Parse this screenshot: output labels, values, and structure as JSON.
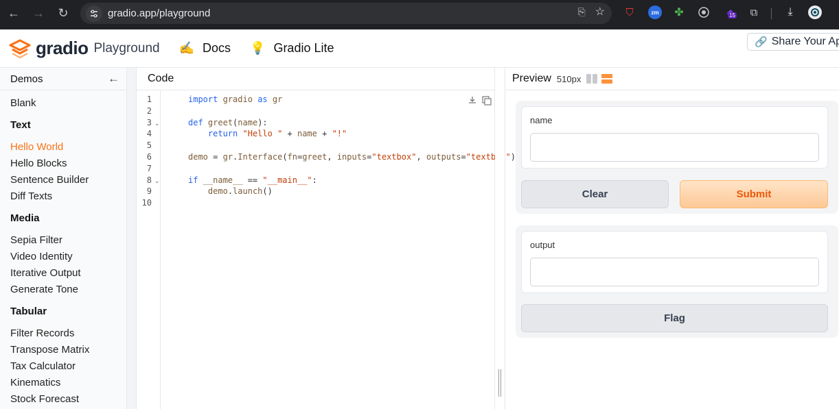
{
  "browser": {
    "url": "gradio.app/playground",
    "extension_badge": "15",
    "zm": "zm"
  },
  "header": {
    "brand": "gradio",
    "brand_sub": "Playground",
    "nav": [
      {
        "emoji": "✍️",
        "label": "Docs"
      },
      {
        "emoji": "💡",
        "label": "Gradio Lite"
      }
    ],
    "share_label": "Share Your App"
  },
  "sidebar": {
    "title": "Demos",
    "items": [
      {
        "label": "Blank",
        "type": "item"
      },
      {
        "label": "Text",
        "type": "category"
      },
      {
        "label": "Hello World",
        "type": "item",
        "active": true
      },
      {
        "label": "Hello Blocks",
        "type": "item"
      },
      {
        "label": "Sentence Builder",
        "type": "item"
      },
      {
        "label": "Diff Texts",
        "type": "item"
      },
      {
        "label": "Media",
        "type": "category"
      },
      {
        "label": "Sepia Filter",
        "type": "item"
      },
      {
        "label": "Video Identity",
        "type": "item"
      },
      {
        "label": "Iterative Output",
        "type": "item"
      },
      {
        "label": "Generate Tone",
        "type": "item"
      },
      {
        "label": "Tabular",
        "type": "category"
      },
      {
        "label": "Filter Records",
        "type": "item"
      },
      {
        "label": "Transpose Matrix",
        "type": "item"
      },
      {
        "label": "Tax Calculator",
        "type": "item"
      },
      {
        "label": "Kinematics",
        "type": "item"
      },
      {
        "label": "Stock Forecast",
        "type": "item"
      }
    ]
  },
  "code": {
    "title": "Code",
    "line_numbers": [
      "1",
      "2",
      "3",
      "4",
      "5",
      "6",
      "7",
      "8",
      "9",
      "10"
    ],
    "lines": [
      "import gradio as gr",
      "",
      "def greet(name):",
      "    return \"Hello \" + name + \"!\"",
      "",
      "demo = gr.Interface(fn=greet, inputs=\"textbox\", outputs=\"textbox\")",
      "",
      "if __name__ == \"__main__\":",
      "    demo.launch()",
      ""
    ]
  },
  "preview": {
    "title": "Preview",
    "width_label": "510px",
    "input_label": "name",
    "clear_label": "Clear",
    "submit_label": "Submit",
    "output_label": "output",
    "flag_label": "Flag"
  },
  "colors": {
    "accent": "#f97316",
    "chrome": "#202124"
  }
}
